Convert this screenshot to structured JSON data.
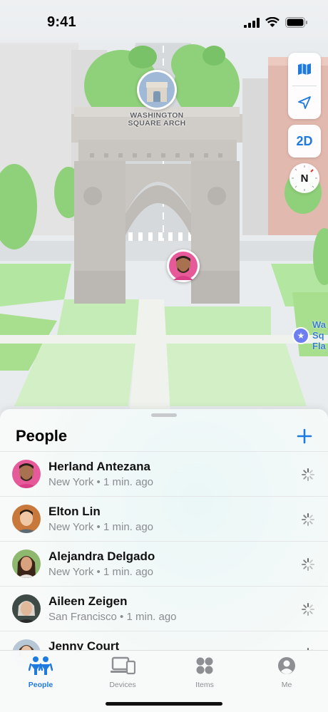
{
  "status_bar": {
    "time": "9:41"
  },
  "map": {
    "landmark": {
      "label_line1": "WASHINGTON",
      "label_line2": "SQUARE ARCH",
      "icon": "arch-landmark-icon"
    },
    "poi": {
      "label": "Wa\nSq\nFla",
      "icon": "star-icon"
    },
    "controls": {
      "map_icon": "map-icon",
      "location_icon": "location-arrow-icon",
      "view_toggle": "2D",
      "compass_letter": "N"
    },
    "colors": {
      "accent": "#1f7ae0",
      "grass": "#a7df8e",
      "building": "#e0b6ac"
    }
  },
  "sheet": {
    "title": "People",
    "add_icon": "plus-icon",
    "people": [
      {
        "name": "Herland Antezana",
        "location": "New York",
        "time": "1 min. ago",
        "separator": "•"
      },
      {
        "name": "Elton Lin",
        "location": "New York",
        "time": "1 min. ago",
        "separator": "•"
      },
      {
        "name": "Alejandra Delgado",
        "location": "New York",
        "time": "1 min. ago",
        "separator": "•"
      },
      {
        "name": "Aileen Zeigen",
        "location": "San Francisco",
        "time": "1 min. ago",
        "separator": "•"
      },
      {
        "name": "Jenny Court",
        "location": "",
        "time": "",
        "separator": ""
      }
    ]
  },
  "tab_bar": {
    "tabs": [
      {
        "label": "People",
        "icon": "people-icon",
        "active": true
      },
      {
        "label": "Devices",
        "icon": "devices-icon",
        "active": false
      },
      {
        "label": "Items",
        "icon": "items-icon",
        "active": false
      },
      {
        "label": "Me",
        "icon": "me-icon",
        "active": false
      }
    ]
  }
}
